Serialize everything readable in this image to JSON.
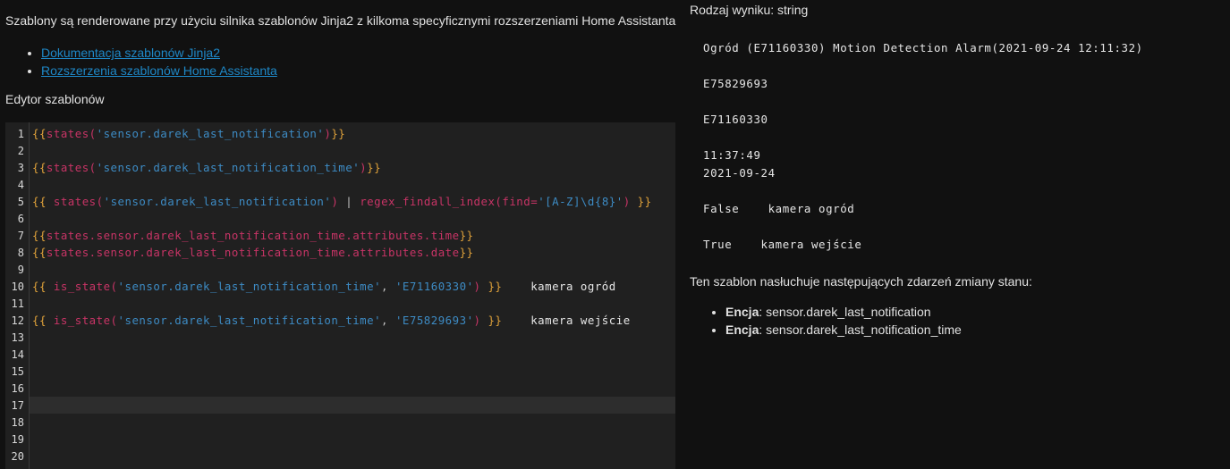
{
  "left": {
    "intro": "Szablony są renderowane przy użyciu silnika szablonów Jinja2 z kilkoma specyficznymi rozszerzeniami Home Assistanta.",
    "links": [
      "Dokumentacja szablonów Jinja2",
      "Rozszerzenia szablonów Home Assistanta"
    ],
    "editor_label": "Edytor szablonów",
    "line_numbers": [
      "1",
      "2",
      "3",
      "4",
      "5",
      "6",
      "7",
      "8",
      "9",
      "10",
      "11",
      "12",
      "13",
      "14",
      "15",
      "16",
      "17",
      "18",
      "19",
      "20"
    ]
  },
  "right": {
    "result_type": "Rodzaj wyniku: string",
    "output": " Ogród (E71160330) Motion Detection Alarm(2021-09-24 12:11:32)\n\n E75829693\n\n E71160330\n\n 11:37:49\n 2021-09-24\n\n False    kamera ogród\n\n True    kamera wejście",
    "listens_label": "Ten szablon nasłuchuje następujących zdarzeń zmiany stanu:",
    "entities": [
      {
        "label": "Encja",
        "value": ": sensor.darek_last_notification"
      },
      {
        "label": "Encja",
        "value": ": sensor.darek_last_notification_time"
      }
    ]
  },
  "code": {
    "l1_open": "{{",
    "l1_fn": "states(",
    "l1_str": "'sensor.darek_last_notification'",
    "l1_close_paren": ")",
    "l1_close": "}}",
    "l3_open": "{{",
    "l3_fn": "states(",
    "l3_str": "'sensor.darek_last_notification_time'",
    "l3_close_paren": ")",
    "l3_close": "}}",
    "l5_open": "{{",
    "l5_fn": " states(",
    "l5_str": "'sensor.darek_last_notification'",
    "l5_close_paren": ")",
    "l5_pipe": " | ",
    "l5_filter": "regex_findall_index(find=",
    "l5_regex": "'[A-Z]\\d{8}'",
    "l5_close_paren2": ") ",
    "l5_close": "}}",
    "l7_open": "{{",
    "l7_var": "states.sensor.darek_last_notification_time.attributes.time",
    "l7_close": "}}",
    "l8_open": "{{",
    "l8_var": "states.sensor.darek_last_notification_time.attributes.date",
    "l8_close": "}}",
    "l10_open": "{{",
    "l10_fn": " is_state(",
    "l10_str1": "'sensor.darek_last_notification_time'",
    "l10_comma": ", ",
    "l10_str2": "'E71160330'",
    "l10_close_paren": ") ",
    "l10_close": "}}",
    "l10_text": "    kamera ogród",
    "l12_open": "{{",
    "l12_fn": " is_state(",
    "l12_str1": "'sensor.darek_last_notification_time'",
    "l12_comma": ", ",
    "l12_str2": "'E75829693'",
    "l12_close_paren": ") ",
    "l12_close": "}}",
    "l12_text": "    kamera wejście"
  }
}
